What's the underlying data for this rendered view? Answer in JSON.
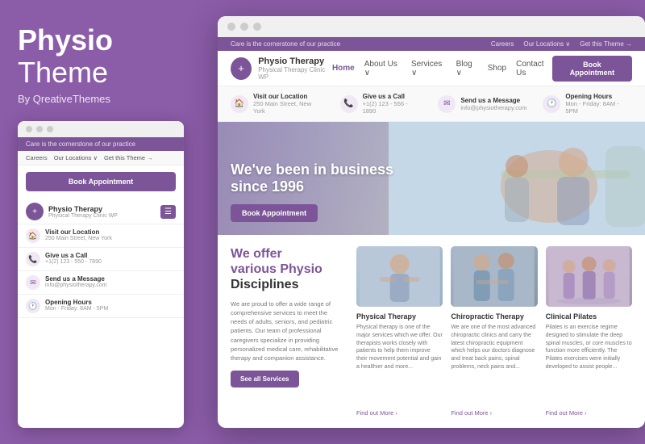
{
  "left_panel": {
    "brand": {
      "bold": "Physio",
      "light": "Theme",
      "by": "By QreativeThemes"
    },
    "mini_browser": {
      "top_bar": "Care is the cornerstone of our practice",
      "nav_items": [
        "Careers",
        "Our Locations ∨",
        "Get this Theme →"
      ],
      "book_btn": "Book Appointment",
      "logo": {
        "name": "Physio Therapy",
        "sub": "Physical Therapy Clinic WP"
      },
      "info_items": [
        {
          "icon": "🏠",
          "label": "Visit our Location",
          "value": "250 Main Street, New York"
        },
        {
          "icon": "📞",
          "label": "Give us a Call",
          "value": "+1(2) 123 - 550 - 7890"
        },
        {
          "icon": "✉",
          "label": "Send us a Message",
          "value": "info@physiotherapy.com"
        },
        {
          "icon": "🕐",
          "label": "Opening Hours",
          "value": "Mon - Friday: 8AM - 5PM"
        }
      ]
    }
  },
  "main_browser": {
    "top_bar": {
      "tagline": "Care is the cornerstone of our practice",
      "links": [
        "Careers",
        "Our Locations ∨",
        "Get this Theme →"
      ]
    },
    "nav": {
      "logo_name": "Physio Therapy",
      "logo_sub": "Physical Therapy Clinic WP",
      "links": [
        "Home",
        "About Us ∨",
        "Services ∨",
        "Blog ∨",
        "Shop",
        "Contact Us"
      ],
      "active": "Home",
      "book_btn": "Book Appointment"
    },
    "info_strip": [
      {
        "icon": "🏠",
        "label": "Visit our Location",
        "value": "250 Main Street, New York"
      },
      {
        "icon": "📞",
        "label": "Give us a Call",
        "value": "+1(2) 123 - 556 - 1890"
      },
      {
        "icon": "✉",
        "label": "Send us a Message",
        "value": "info@physiotherapy.com"
      },
      {
        "icon": "🕐",
        "label": "Opening Hours",
        "value": "Mon - Friday: 8AM - 5PM"
      }
    ],
    "hero": {
      "title": "We've been in business\nsince 1996",
      "book_btn": "Book Appointment"
    },
    "content": {
      "main_title_purple": "We offer\nvarious Physio",
      "main_title_black": "Disciplines",
      "description": "We are proud to offer a wide range of comprehensive services to meet the needs of adults, seniors, and pediatric patients. Our team of professional caregivers specialize in providing personalized medical care, rehabilitative therapy and companion assistance.",
      "services_btn": "See all Services",
      "cards": [
        {
          "title": "Physical Therapy",
          "description": "Physical therapy is one of the major services which we offer. Our therapists works closely with patients to help them improve their movement potential and gain a healthier and more...",
          "link": "Find out More ›"
        },
        {
          "title": "Chiropractic Therapy",
          "description": "We are one of the most advanced chiropractic clinics and carry the latest chiropractic equipment which helps our doctors diagnose and treat back pains, spinal problems, neck pains and...",
          "link": "Find out More ›"
        },
        {
          "title": "Clinical Pilates",
          "description": "Pilates is an exercise regime designed to stimulate the deep spinal muscles, or core muscles to function more efficiently. The Pilates exercises were initially developed to assist people...",
          "link": "Find out More ›"
        }
      ]
    }
  }
}
